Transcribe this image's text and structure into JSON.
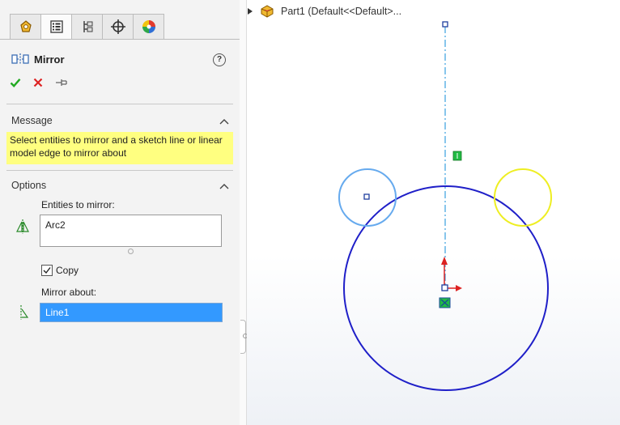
{
  "panel": {
    "tabs": [
      {
        "icon": "feature-manager-icon"
      },
      {
        "icon": "property-manager-icon"
      },
      {
        "icon": "configuration-manager-icon"
      },
      {
        "icon": "dimxpert-manager-icon"
      },
      {
        "icon": "display-manager-icon"
      }
    ],
    "title": "Mirror",
    "title_icon": "mirror-icon",
    "help_label": "?",
    "actions": [
      {
        "icon": "ok-check-icon",
        "color": "#22aa22"
      },
      {
        "icon": "cancel-x-icon",
        "color": "#dd2222"
      },
      {
        "icon": "pushpin-icon",
        "color": "#666666"
      }
    ],
    "message": {
      "title": "Message",
      "text": "Select entities to mirror and a sketch line or linear model edge to mirror about",
      "bg_color": "#ffff80"
    },
    "options": {
      "title": "Options",
      "entities_label": "Entities to mirror:",
      "entities": [
        "Arc2"
      ],
      "copy_label": "Copy",
      "copy_checked": true,
      "mirror_about_label": "Mirror about:",
      "mirror_about_value": "Line1",
      "selection_color": "#3399ff"
    }
  },
  "tree": {
    "label": "Part1  (Default<<Default>..."
  },
  "sketch": {
    "colors": {
      "main_circle": "#1f1fc8",
      "source_circle": "#66aaee",
      "mirrored_circle": "#eeee22",
      "centerline": "#3aa0e0"
    }
  }
}
